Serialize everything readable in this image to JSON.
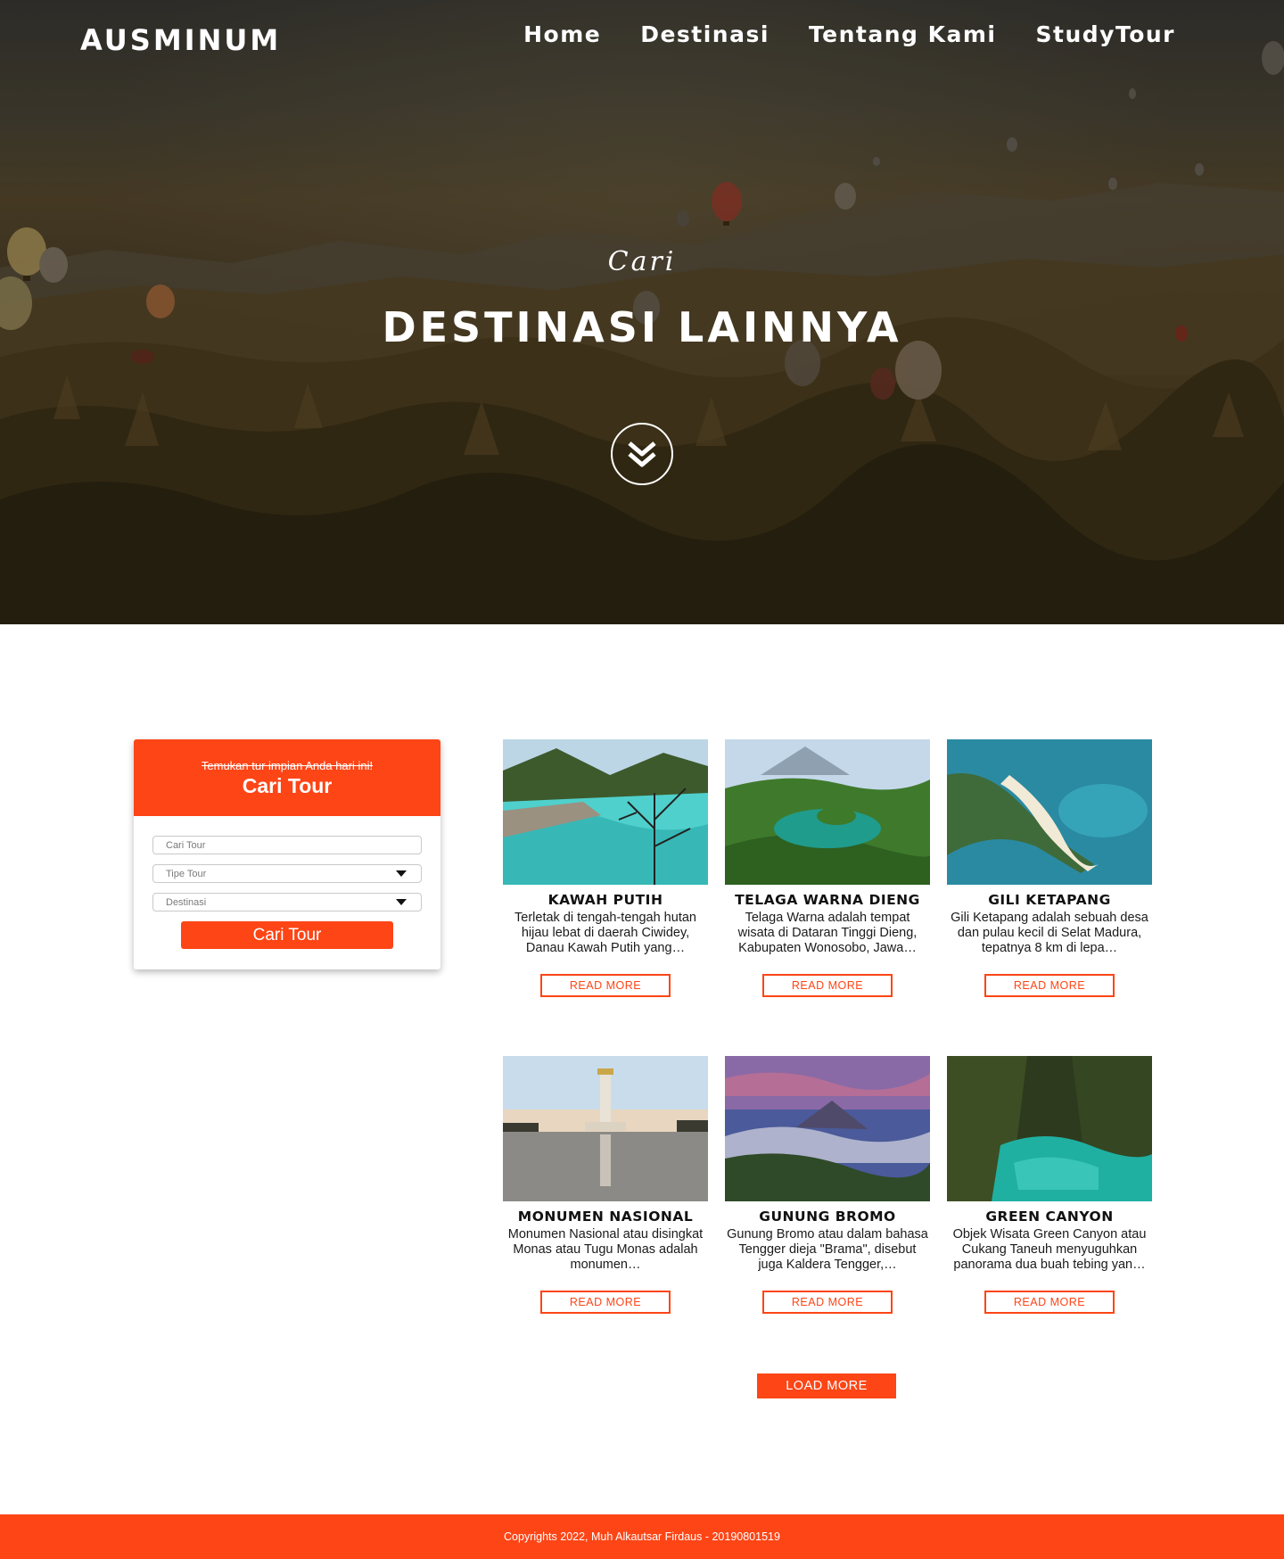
{
  "brand": "AUSMINUM",
  "nav": [
    "Home",
    "Destinasi",
    "Tentang Kami",
    "StudyTour"
  ],
  "hero": {
    "subtitle": "Cari",
    "title": "DESTINASI LAINNYA"
  },
  "search": {
    "tagline": "Temukan tur impian Anda hari ini!",
    "title": "Cari Tour",
    "fields": [
      "Cari Tour",
      "Tipe Tour",
      "Destinasi"
    ],
    "button": "Cari Tour"
  },
  "destinations": [
    {
      "name": "KAWAH PUTIH",
      "desc": "Terletak di tengah-tengah hutan hijau lebat di daerah Ciwidey, Danau Kawah Putih yang…",
      "button": "READ MORE"
    },
    {
      "name": "TELAGA WARNA DIENG",
      "desc": "Telaga Warna adalah tempat wisata di Dataran Tinggi Dieng, Kabupaten Wonosobo, Jawa…",
      "button": "READ MORE"
    },
    {
      "name": "GILI KETAPANG",
      "desc": "Gili Ketapang adalah sebuah desa dan pulau kecil di Selat Madura, tepatnya 8 km di lepa…",
      "button": "READ MORE"
    },
    {
      "name": "MONUMEN NASIONAL",
      "desc": "Monumen Nasional atau disingkat Monas atau Tugu Monas adalah monumen…",
      "button": "READ MORE"
    },
    {
      "name": "GUNUNG BROMO",
      "desc": "Gunung Bromo atau dalam bahasa Tengger dieja \"Brama\", disebut juga Kaldera Tengger,…",
      "button": "READ MORE"
    },
    {
      "name": "GREEN CANYON",
      "desc": "Objek Wisata Green Canyon atau Cukang Taneuh menyuguhkan panorama dua buah tebing yan…",
      "button": "READ MORE"
    }
  ],
  "load_more": "LOAD MORE",
  "footer": "Copyrights 2022, Muh Alkautsar Firdaus - 20190801519",
  "colors": {
    "accent": "#fd4516",
    "hero_overlay": "#2c2418"
  },
  "icons": {
    "scroll": "double-chevron-down-icon",
    "select": "caret-down-icon"
  }
}
